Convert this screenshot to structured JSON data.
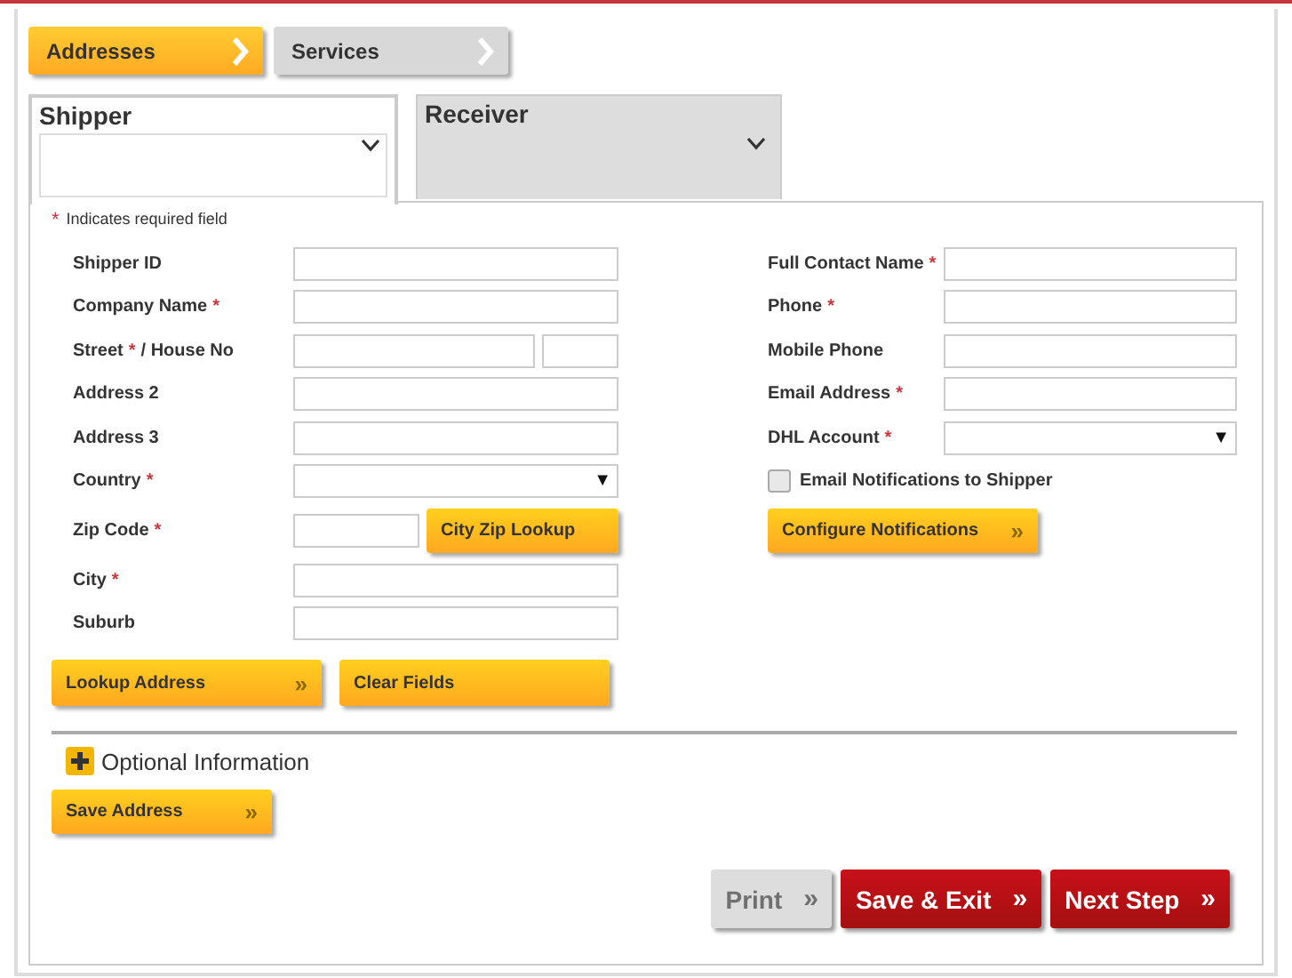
{
  "steps": [
    {
      "label": "Addresses",
      "selected": true
    },
    {
      "label": "Services",
      "selected": false
    }
  ],
  "parties": [
    {
      "label": "Shipper",
      "selected": true
    },
    {
      "label": "Receiver",
      "selected": false
    }
  ],
  "required_note": {
    "mark": "*",
    "text": "Indicates required field"
  },
  "left_fields": [
    {
      "kind": "text",
      "label": "Shipper ID"
    },
    {
      "kind": "text",
      "label": "Company Name",
      "mark": "*"
    },
    {
      "kind": "split",
      "label": "Street",
      "mark": "*",
      "label_2": "/ House No"
    },
    {
      "kind": "text",
      "label": "Address 2"
    },
    {
      "kind": "text",
      "label": "Address 3"
    },
    {
      "kind": "select",
      "label": "Country",
      "mark": "*",
      "arrow": "▼"
    },
    {
      "kind": "zip",
      "label": "Zip Code",
      "mark": "*",
      "button": "City Zip Lookup"
    },
    {
      "kind": "text",
      "label": "City",
      "mark": "*"
    },
    {
      "kind": "text",
      "label": "Suburb"
    }
  ],
  "left_buttons": [
    {
      "label": "Lookup Address",
      "arrow": "»"
    },
    {
      "label": "Clear Fields"
    }
  ],
  "right_fields": [
    {
      "kind": "text",
      "label": "Full Contact Name",
      "mark": "*"
    },
    {
      "kind": "text",
      "label": "Phone",
      "mark": "*"
    },
    {
      "kind": "text",
      "label": "Mobile Phone"
    },
    {
      "kind": "text",
      "label": "Email Address",
      "mark": "*"
    },
    {
      "kind": "select",
      "label": "DHL Account",
      "mark": "*",
      "arrow": "▼"
    }
  ],
  "notify_checkbox": {
    "label": "Email Notifications to Shipper",
    "checked": false
  },
  "configure_button": {
    "label": "Configure Notifications",
    "arrow": "»"
  },
  "optional_section": {
    "label": "Optional Information",
    "expanded": false
  },
  "save_address_button": {
    "label": "Save Address",
    "arrow": "»"
  },
  "footer_buttons": [
    {
      "label": "Print",
      "arrow": "»",
      "disabled": true
    },
    {
      "label": "Save & Exit",
      "arrow": "»",
      "disabled": false
    },
    {
      "label": "Next Step",
      "arrow": "»",
      "disabled": false
    }
  ]
}
